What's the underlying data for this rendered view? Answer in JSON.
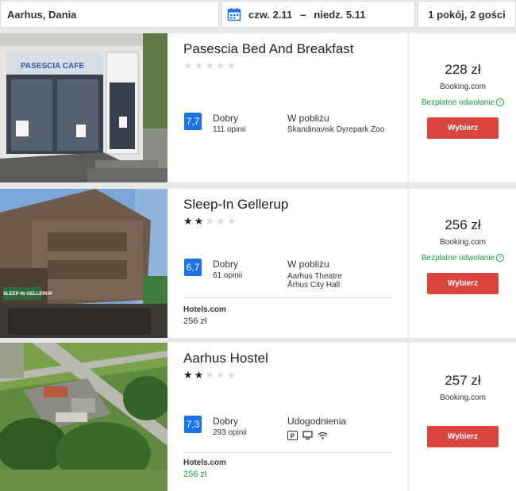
{
  "search": {
    "destination": "Aarhus, Dania",
    "checkin": "czw. 2.11",
    "dash": "–",
    "checkout": "niedz. 5.11",
    "guests": "1 pokój, 2 gości"
  },
  "colors": {
    "accent": "#1a73e8",
    "button": "#d9453d",
    "green": "#1e9e3c"
  },
  "hotels": [
    {
      "name": "Pasescia Bed And Breakfast",
      "stars": 0,
      "rating": "7,7",
      "rating_label": "Dobry",
      "reviews": "111 opinii",
      "feature_title": "W pobliżu",
      "feature_lines": [
        "Skandinavisk Dyrepark Zoo"
      ],
      "photo_sign": "PASESCIA CAFE",
      "price": "228 zł",
      "provider": "Booking.com",
      "cancel": "Bezpłatne odwołanie",
      "button": "Wybierz"
    },
    {
      "name": "Sleep-In Gellerup",
      "stars": 2,
      "rating": "6,7",
      "rating_label": "Dobry",
      "reviews": "61 opinii",
      "feature_title": "W pobliżu",
      "feature_lines": [
        "Aarhus Theatre",
        "Århus City Hall"
      ],
      "photo_sign": "SLEEP-IN GELLERUP",
      "alt_provider": "Hotels.com",
      "alt_price": "256 zł",
      "price": "256 zł",
      "provider": "Booking.com",
      "cancel": "Bezpłatne odwołanie",
      "button": "Wybierz"
    },
    {
      "name": "Aarhus Hostel",
      "stars": 2,
      "rating": "7,3",
      "rating_label": "Dobry",
      "reviews": "293 opinii",
      "feature_title": "Udogodnienia",
      "amenities": [
        "parking-icon",
        "computer-icon",
        "wifi-icon"
      ],
      "alt_provider": "Hotels.com",
      "alt_price": "256 zł",
      "price": "257 zł",
      "provider": "Booking.com",
      "button": "Wybierz"
    }
  ]
}
